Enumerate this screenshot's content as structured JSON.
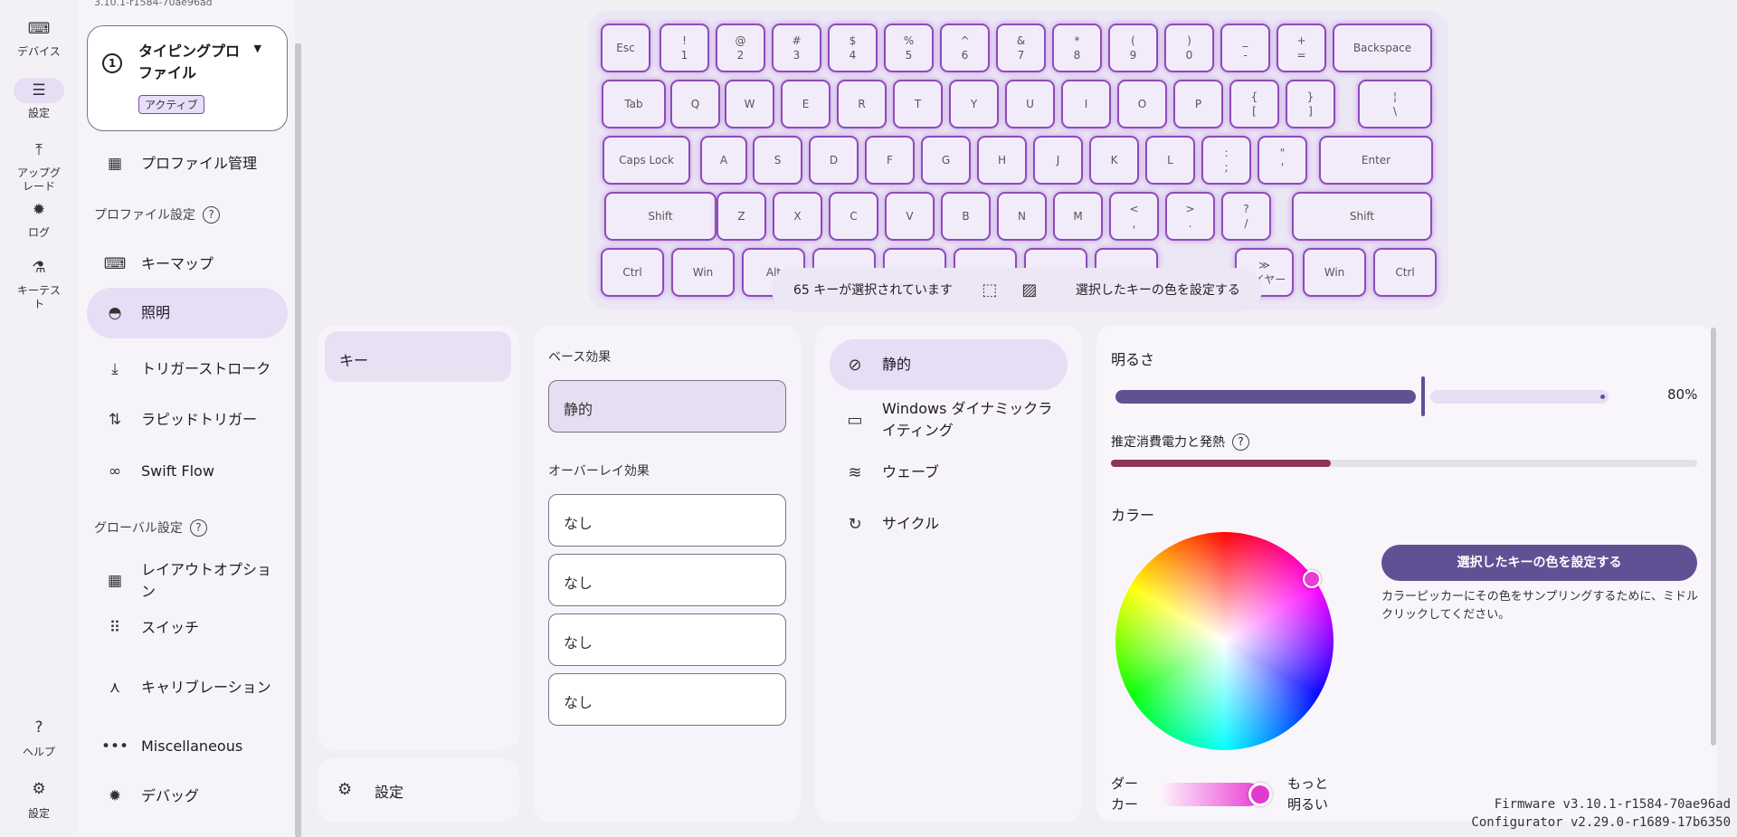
{
  "version_top": "3.10.1-r1584-70ae96ad",
  "rail": [
    {
      "label": "デバイス",
      "icon": "keyboard-icon"
    },
    {
      "label": "設定",
      "icon": "tune-icon",
      "active": true
    },
    {
      "label": "アップグレード",
      "icon": "upload-icon"
    },
    {
      "label": "ログ",
      "icon": "bug-icon"
    },
    {
      "label": "キーテスト",
      "icon": "test-tube-icon"
    }
  ],
  "rail_bottom": [
    {
      "label": "ヘルプ",
      "icon": "help-icon"
    },
    {
      "label": "設定",
      "icon": "gear-icon"
    }
  ],
  "profile": {
    "number": "1",
    "name": "タイピングプロファイル",
    "badge": "アクティブ"
  },
  "sidebar": {
    "profile_manage": "プロファイル管理",
    "profile_settings_head": "プロファイル設定",
    "global_settings_head": "グローバル設定",
    "items": [
      {
        "label": "キーマップ",
        "icon": "keyboard-icon"
      },
      {
        "label": "照明",
        "icon": "sunrise-icon",
        "active": true
      },
      {
        "label": "トリガーストローク",
        "icon": "download-icon"
      },
      {
        "label": "ラピッドトリガー",
        "icon": "swap-icon"
      },
      {
        "label": "Swift Flow",
        "icon": "flow-icon"
      }
    ],
    "global_items": [
      {
        "label": "レイアウトオプション",
        "icon": "layout-icon"
      },
      {
        "label": "スイッチ",
        "icon": "switch-icon"
      },
      {
        "label": "キャリブレーション",
        "icon": "compass-icon"
      },
      {
        "label": "Miscellaneous",
        "icon": "more-icon"
      },
      {
        "label": "デバッグ",
        "icon": "bug-icon"
      }
    ]
  },
  "keyboard": {
    "rows": [
      [
        [
          "Esc",
          ""
        ],
        [
          "!",
          "1"
        ],
        [
          "@",
          "2"
        ],
        [
          "#",
          "3"
        ],
        [
          "$",
          "4"
        ],
        [
          "%",
          "5"
        ],
        [
          "^",
          "6"
        ],
        [
          "&",
          "7"
        ],
        [
          "*",
          "8"
        ],
        [
          "(",
          "9"
        ],
        [
          ")",
          "0"
        ],
        [
          "_",
          "-"
        ],
        [
          "+",
          "="
        ],
        [
          "Backspace",
          ""
        ]
      ],
      [
        [
          "Tab",
          ""
        ],
        [
          "Q",
          ""
        ],
        [
          "W",
          ""
        ],
        [
          "E",
          ""
        ],
        [
          "R",
          ""
        ],
        [
          "T",
          ""
        ],
        [
          "Y",
          ""
        ],
        [
          "U",
          ""
        ],
        [
          "I",
          ""
        ],
        [
          "O",
          ""
        ],
        [
          "P",
          ""
        ],
        [
          "{",
          "["
        ],
        [
          "}",
          "]"
        ],
        [
          "¦",
          "\\"
        ]
      ],
      [
        [
          "Caps Lock",
          ""
        ],
        [
          "A",
          ""
        ],
        [
          "S",
          ""
        ],
        [
          "D",
          ""
        ],
        [
          "F",
          ""
        ],
        [
          "G",
          ""
        ],
        [
          "H",
          ""
        ],
        [
          "J",
          ""
        ],
        [
          "K",
          ""
        ],
        [
          "L",
          ""
        ],
        [
          ":",
          ";"
        ],
        [
          "\"",
          "'"
        ],
        [
          "Enter",
          ""
        ]
      ],
      [
        [
          "Shift",
          ""
        ],
        [
          "Z",
          ""
        ],
        [
          "X",
          ""
        ],
        [
          "C",
          ""
        ],
        [
          "V",
          ""
        ],
        [
          "B",
          ""
        ],
        [
          "N",
          ""
        ],
        [
          "M",
          ""
        ],
        [
          "<",
          ","
        ],
        [
          ">",
          "."
        ],
        [
          "?",
          "/"
        ],
        [
          "Shift",
          ""
        ]
      ],
      [
        [
          "Ctrl",
          ""
        ],
        [
          "Win",
          ""
        ],
        [
          "Alt",
          ""
        ],
        [
          "",
          ""
        ],
        [
          "",
          ""
        ],
        [
          "",
          ""
        ],
        [
          "",
          ""
        ],
        [
          "",
          ""
        ],
        [
          "≫",
          "レイヤー"
        ],
        [
          "Win",
          ""
        ],
        [
          "Ctrl",
          ""
        ]
      ]
    ]
  },
  "selection_bar": {
    "count_text": "65 キーが選択されています",
    "action": "選択したキーの色を設定する"
  },
  "layers": {
    "selected": "キー",
    "settings": "設定"
  },
  "effects": {
    "base_head": "ベース効果",
    "base_value": "静的",
    "overlay_head": "オーバーレイ効果",
    "overlays": [
      "なし",
      "なし",
      "なし",
      "なし"
    ]
  },
  "effect_list": [
    {
      "label": "静的",
      "icon": "block-icon",
      "active": true
    },
    {
      "label": "Windows ダイナミックライティング",
      "icon": "monitor-icon"
    },
    {
      "label": "ウェーブ",
      "icon": "waves-icon"
    },
    {
      "label": "サイクル",
      "icon": "cycle-icon"
    }
  ],
  "settings_panel": {
    "brightness_label": "明るさ",
    "brightness_value": "80%",
    "brightness_fraction": 0.8,
    "power_label": "推定消費電力と発熱",
    "power_fraction": 0.37,
    "color_label": "カラー",
    "color_button": "選択したキーの色を設定する",
    "color_hint": "カラーピッカーにその色をサンプリングするために、ミドルクリックしてください。",
    "selected_color": "#ea3fd5",
    "darker_label": "ダーカー",
    "brighter_label": "もっと明るい"
  },
  "footer": {
    "firmware": "Firmware v3.10.1-r1584-70ae96ad",
    "configurator": "Configurator v2.29.0-r1689-17b6350"
  },
  "accent": "#625095"
}
